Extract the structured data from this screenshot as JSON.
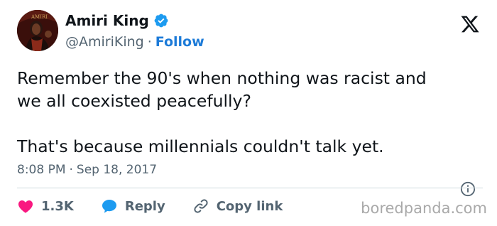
{
  "author": {
    "display_name": "Amiri King",
    "handle": "@AmiriKing",
    "separator": "·",
    "follow_label": "Follow",
    "avatar_icon": "profile-photo",
    "verified_icon": "verified-badge-icon",
    "verified_color": "#1d9bf0"
  },
  "platform": {
    "logo_icon": "x-logo-icon"
  },
  "tweet": {
    "line1": "Remember the 90's when nothing was racist and",
    "line2": "we all coexisted peacefully?",
    "line3": "That's because millennials couldn't talk yet."
  },
  "meta": {
    "time": "8:08 PM",
    "separator": "·",
    "date": "Sep 18, 2017",
    "info_icon": "info-icon"
  },
  "actions": {
    "likes_count": "1.3K",
    "like_icon": "heart-icon",
    "like_color": "#f91880",
    "reply_label": "Reply",
    "reply_icon": "speech-bubble-icon",
    "reply_color": "#1d9bf0",
    "copy_label": "Copy link",
    "copy_icon": "link-icon"
  },
  "watermark": "boredpanda.com",
  "colors": {
    "text": "#0f1419",
    "secondary": "#536471",
    "link": "#1d7bd8",
    "divider": "#cfd9de",
    "watermark": "#a9a9a9"
  }
}
